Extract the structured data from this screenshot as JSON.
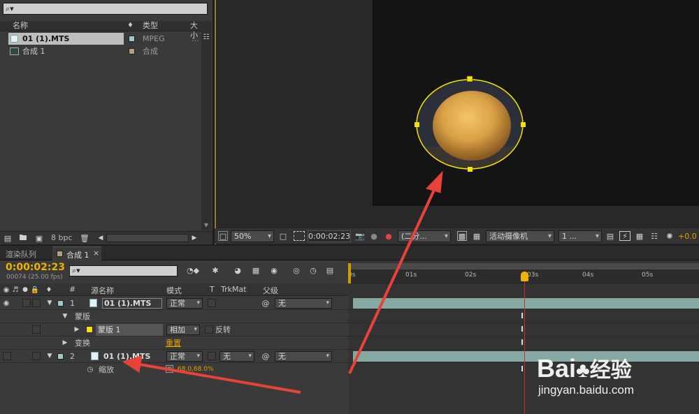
{
  "project": {
    "search_placeholder": "⌕▾",
    "col_name": "名称",
    "col_type": "类型",
    "col_size": "大小",
    "items": [
      {
        "name": "01 (1).MTS",
        "type": "MPEG",
        "size": "...",
        "color": "#9fc8c8",
        "selected": true
      },
      {
        "name": "合成 1",
        "type": "合成",
        "size": "",
        "color": "#b29f82",
        "selected": false
      }
    ],
    "bpc": "8 bpc"
  },
  "viewer": {
    "zoom": "50%",
    "timecode": "0:00:02:23",
    "resolution": "(二分...",
    "camera": "活动摄像机",
    "views": "1 ...",
    "exposure": "+0.0"
  },
  "tabs": {
    "render_queue": "渲染队列",
    "comp": "合成 1"
  },
  "timeline": {
    "current_time": "0:00:02:23",
    "frame_info": "00074 (25.00 fps)",
    "col_hash": "#",
    "col_source": "源名称",
    "col_mode": "模式",
    "col_t": "T",
    "col_trkmat": "TrkMat",
    "col_parent": "父级",
    "ruler": [
      "0s",
      "01s",
      "02s",
      "03s",
      "04s",
      "05s"
    ],
    "layer1": {
      "num": "1",
      "name": "01 (1).MTS",
      "mode": "正常",
      "parent": "无"
    },
    "masks_group": "蒙版",
    "mask1": {
      "name": "蒙版 1",
      "mode": "相加",
      "invert": "反转"
    },
    "transform": "变换",
    "transform_reset": "重置",
    "layer2": {
      "num": "2",
      "name": "01 (1).MTS",
      "mode": "正常",
      "trkmat": "无",
      "parent": "无"
    },
    "scale_label": "缩放",
    "scale_value": "68.0,68.0%"
  },
  "watermark": {
    "brand": "Bai",
    "brand_cn": "经验",
    "url": "jingyan.baidu.com"
  },
  "colors": {
    "accent": "#f0b400",
    "mask": "#f4e200",
    "clip": "#87a9a3",
    "playhead": "#c83222",
    "arrow": "#e8423a"
  }
}
